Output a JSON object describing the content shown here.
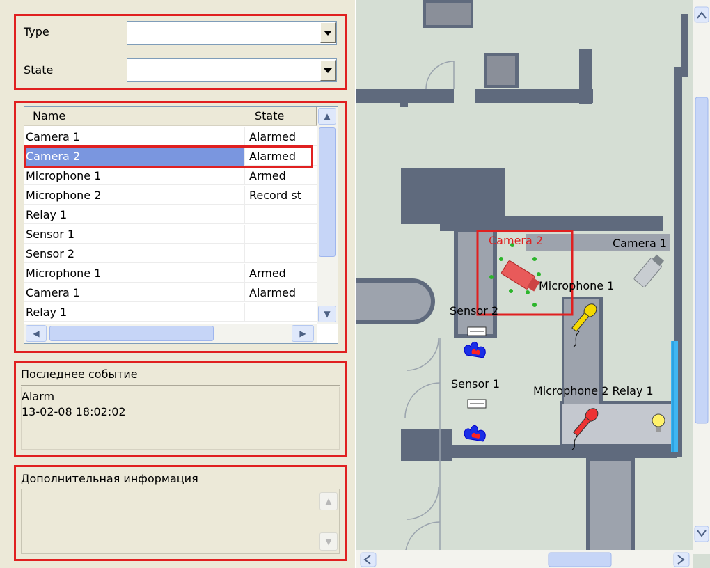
{
  "filters": {
    "type_label": "Type",
    "type_value": "",
    "state_label": "State",
    "state_value": ""
  },
  "list": {
    "columns": [
      "Name",
      "State"
    ],
    "rows": [
      {
        "name": "Camera 1",
        "state": "Alarmed"
      },
      {
        "name": "Camera 2",
        "state": "Alarmed",
        "selected": true
      },
      {
        "name": "Microphone 1",
        "state": "Armed"
      },
      {
        "name": "Microphone 2",
        "state": "Record st"
      },
      {
        "name": "Relay 1",
        "state": ""
      },
      {
        "name": "Sensor 1",
        "state": ""
      },
      {
        "name": "Sensor 2",
        "state": ""
      },
      {
        "name": "Microphone 1",
        "state": "Armed"
      },
      {
        "name": "Camera 1",
        "state": "Alarmed"
      },
      {
        "name": "Relay 1",
        "state": ""
      }
    ]
  },
  "last_event": {
    "title": "Последнее событие",
    "line1": "Alarm",
    "line2": "13-02-08 18:02:02"
  },
  "extra_info": {
    "title": "Дополнительная информация",
    "text": ""
  },
  "map": {
    "labels": {
      "camera2": "Camera 2",
      "camera1": "Camera 1",
      "microphone1": "Microphone 1",
      "sensor2": "Sensor 2",
      "sensor1": "Sensor 1",
      "microphone2_relay1": "Microphone 2 Relay 1"
    }
  },
  "colors": {
    "highlight_red": "#e02020",
    "selection_blue": "#7a96df",
    "wall": "#5f6a7d",
    "floor": "#d5ded4"
  }
}
